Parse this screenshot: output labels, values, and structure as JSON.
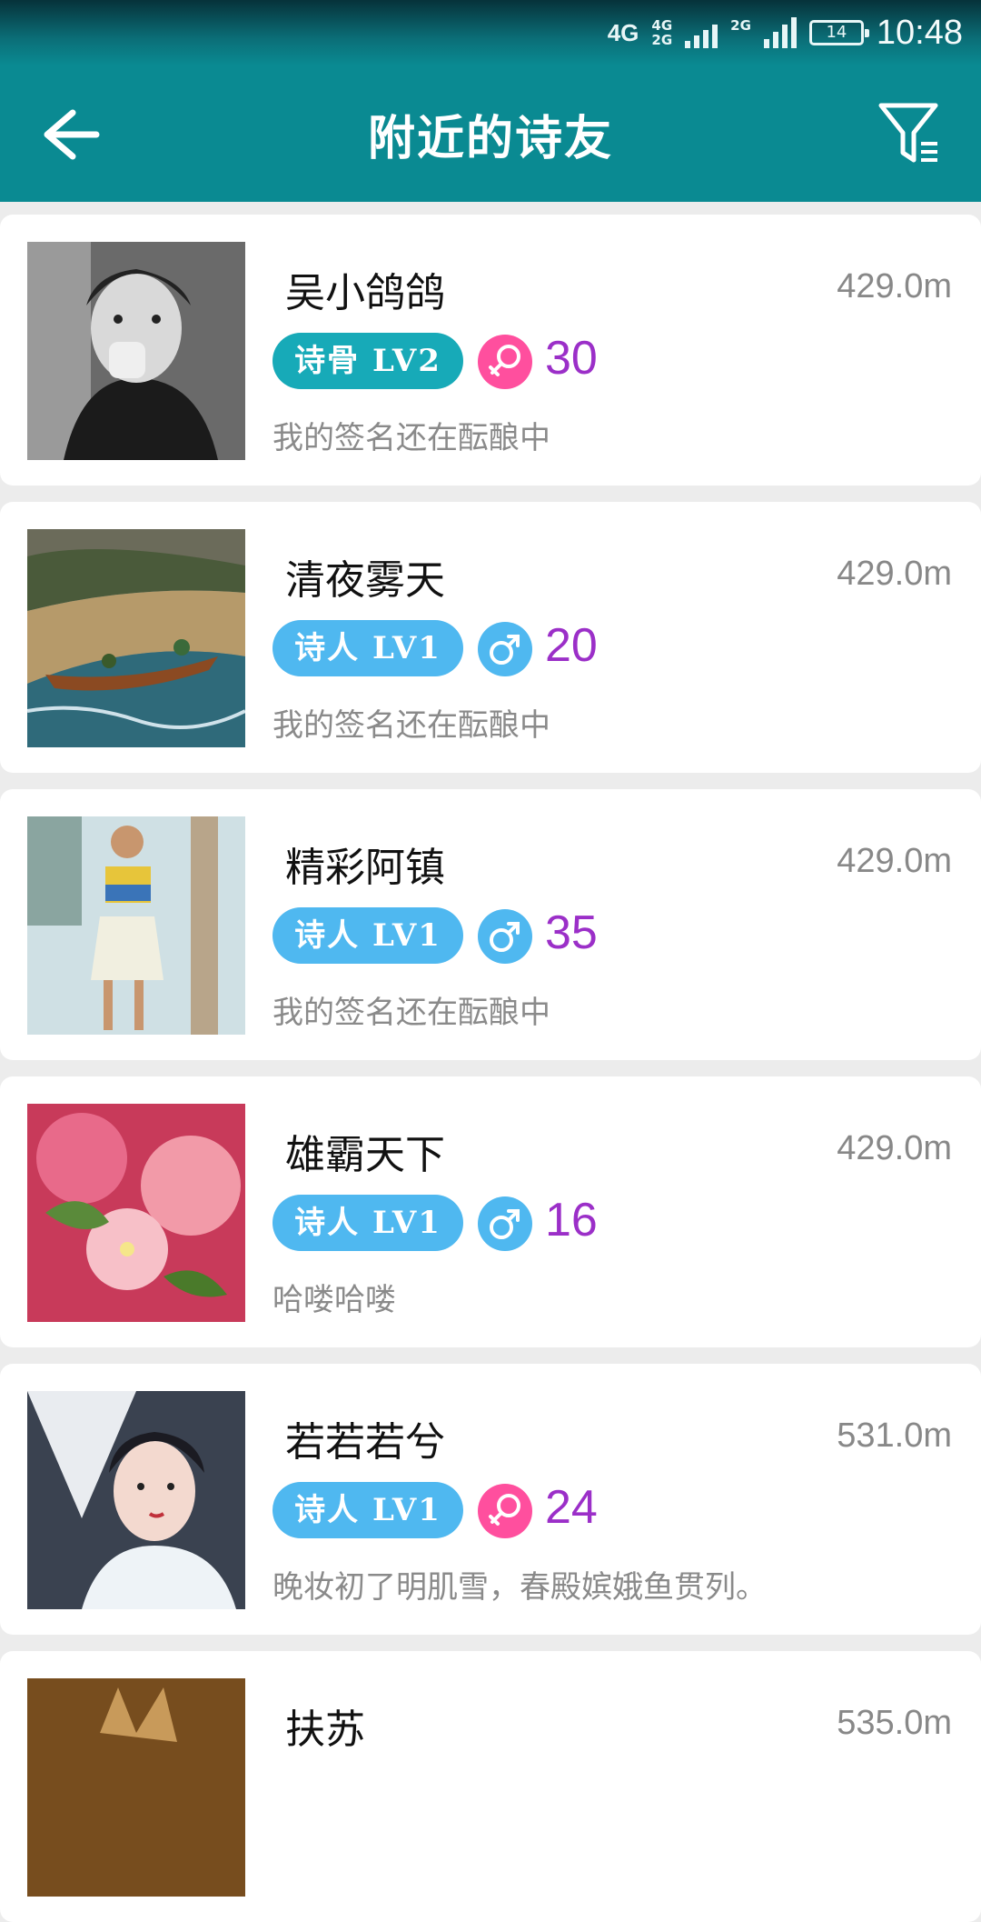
{
  "status_bar": {
    "network_1": "4G",
    "network_2_top": "4G",
    "network_2_bottom": "2G",
    "network_3": "2G",
    "battery": "14",
    "time": "10:48"
  },
  "header": {
    "title": "附近的诗友",
    "back_icon": "arrow-left-icon",
    "filter_icon": "filter-icon"
  },
  "colors": {
    "primary": "#0a8a92",
    "badge_shigu": "#17aab8",
    "badge_shiren": "#4fb8f0",
    "female": "#ff4f9e",
    "male": "#4fb8f0",
    "age": "#9b2fc8"
  },
  "users": [
    {
      "name": "吴小鸽鸽",
      "distance": "429.0m",
      "level": "诗骨  LV2",
      "level_type": "shigu",
      "gender": "female",
      "age": "30",
      "signature": "我的签名还在酝酿中",
      "avatar": "portrait-bw"
    },
    {
      "name": "清夜雾天",
      "distance": "429.0m",
      "level": "诗人  LV1",
      "level_type": "shiren",
      "gender": "male",
      "age": "20",
      "signature": "我的签名还在酝酿中",
      "avatar": "beach-boat"
    },
    {
      "name": "精彩阿镇",
      "distance": "429.0m",
      "level": "诗人  LV1",
      "level_type": "shiren",
      "gender": "male",
      "age": "35",
      "signature": "我的签名还在酝酿中",
      "avatar": "fashion-woman"
    },
    {
      "name": "雄霸天下",
      "distance": "429.0m",
      "level": "诗人  LV1",
      "level_type": "shiren",
      "gender": "male",
      "age": "16",
      "signature": "哈喽哈喽",
      "avatar": "pink-flowers"
    },
    {
      "name": "若若若兮",
      "distance": "531.0m",
      "level": "诗人  LV1",
      "level_type": "shiren",
      "gender": "female",
      "age": "24",
      "signature": "晚妆初了明肌雪，春殿嫔娥鱼贯列。",
      "avatar": "costume-girl"
    },
    {
      "name": "扶苏",
      "distance": "535.0m",
      "level": "",
      "level_type": "",
      "gender": "",
      "age": "",
      "signature": "",
      "avatar": "cat-brown"
    }
  ]
}
